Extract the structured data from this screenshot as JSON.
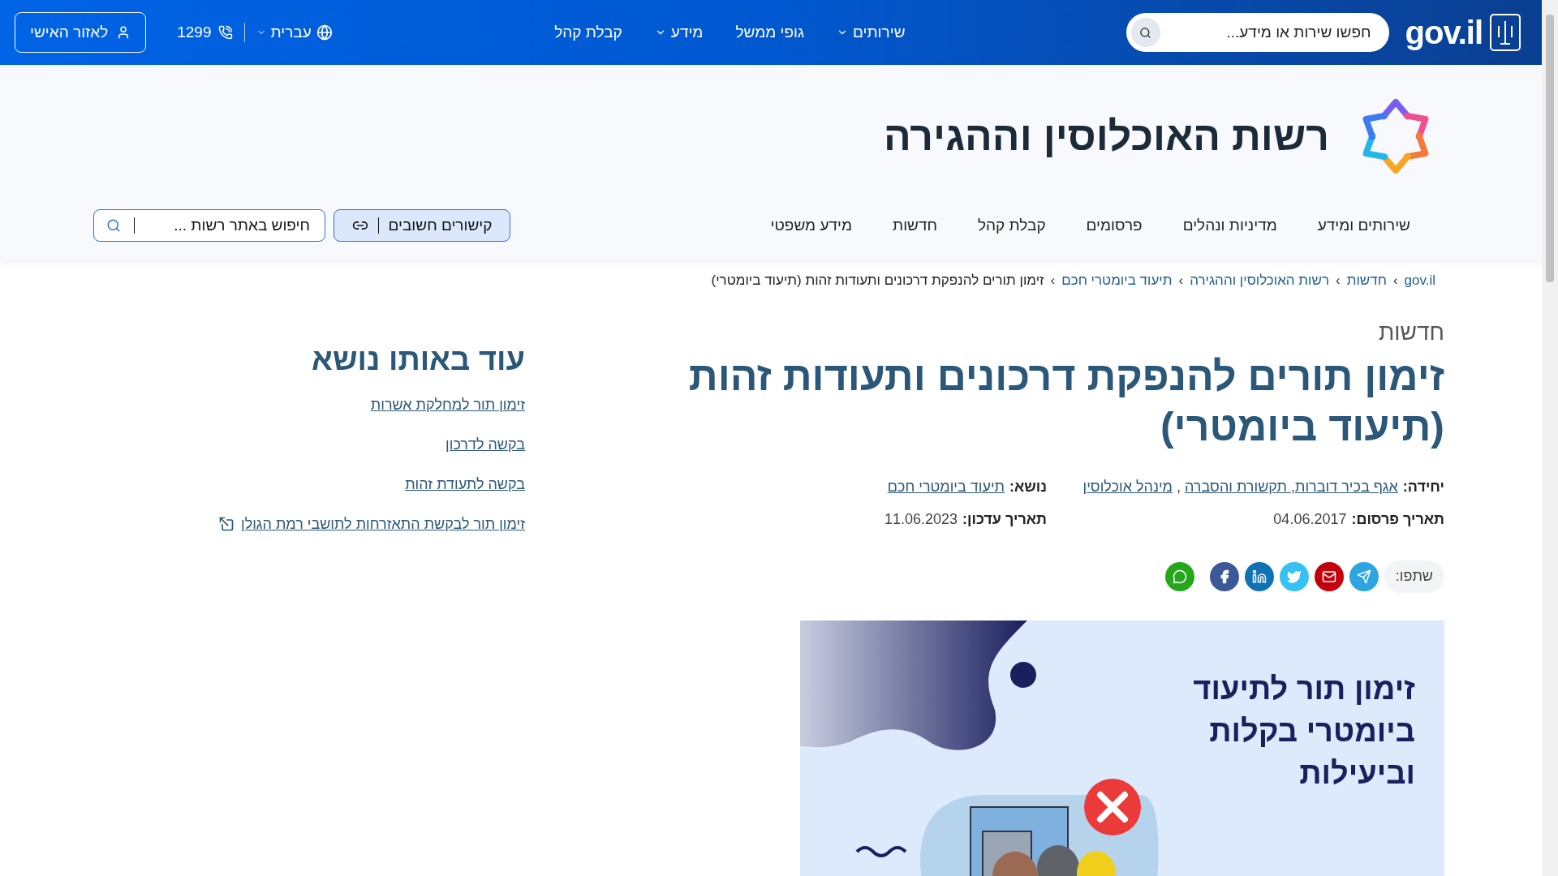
{
  "topbar": {
    "logo": "gov.il",
    "search": {
      "placeholder": "חפשו שירות או מידע..."
    },
    "nav": [
      {
        "label": "שירותים",
        "dropdown": true
      },
      {
        "label": "גופי ממשל",
        "dropdown": false
      },
      {
        "label": "מידע",
        "dropdown": true
      },
      {
        "label": "קבלת קהל",
        "dropdown": false
      }
    ],
    "language": "עברית",
    "phone": "1299",
    "personal_button": "לאזור האישי"
  },
  "header": {
    "title": "רשות האוכלוסין וההגירה",
    "nav": [
      "שירותים ומידע",
      "מדיניות ונהלים",
      "פרסומים",
      "קבלת קהל",
      "חדשות",
      "מידע משפטי"
    ],
    "links_button": "קישורים חשובים",
    "search": {
      "placeholder": "חיפוש באתר רשות ..."
    }
  },
  "breadcrumb": [
    {
      "label": "gov.il",
      "link": true
    },
    {
      "label": "חדשות",
      "link": true,
      "separator": "›"
    },
    {
      "label": "רשות האוכלוסין וההגירה",
      "link": true,
      "separator": "›"
    },
    {
      "label": "תיעוד ביומטרי חכם",
      "link": true,
      "separator": "›"
    },
    {
      "label": "זימון תורים להנפקת דרכונים ותעודות זהות (תיעוד ביומטרי)",
      "link": false,
      "separator": "›"
    }
  ],
  "article": {
    "category": "חדשות",
    "title": "זימון תורים להנפקת דרכונים ותעודות זהות (תיעוד ביומטרי)",
    "meta": [
      {
        "kind": "links",
        "label": "יחידה:",
        "links": [
          "אגף בכיר דוברות, תקשורת והסברה",
          "מינהל אוכלוסין"
        ],
        "separator": ","
      },
      {
        "kind": "links",
        "label": "נושא:",
        "links": [
          "תיעוד ביומטרי חכם"
        ]
      },
      {
        "kind": "text",
        "label": "תאריך פרסום:",
        "value": "04.06.2017"
      },
      {
        "kind": "text",
        "label": "תאריך עדכון:",
        "value": "11.06.2023"
      }
    ],
    "share": {
      "label": "שתפו:",
      "buttons": [
        {
          "kind": "telegram"
        },
        {
          "kind": "email"
        },
        {
          "kind": "twitter"
        },
        {
          "kind": "linkedin"
        },
        {
          "kind": "facebook"
        },
        {
          "kind": "whatsapp"
        }
      ]
    },
    "banner": {
      "lines": [
        "זימון תור לתיעוד",
        "ביומטרי בקלות",
        "וביעילות"
      ]
    }
  },
  "sidebar": {
    "title": "עוד באותו נושא",
    "links": [
      {
        "label": "זימון תור למחלקת אשרות",
        "external": false
      },
      {
        "label": "בקשה לדרכון",
        "external": false
      },
      {
        "label": "בקשה לתעודת זהות",
        "external": false
      },
      {
        "label": "זימון תור לבקשת התאזרחות לתושבי רמת הגולן",
        "external": true
      }
    ]
  }
}
